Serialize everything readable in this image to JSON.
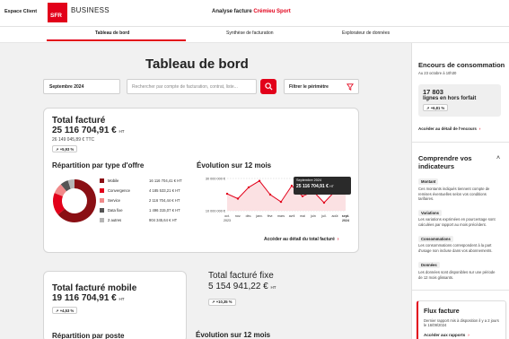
{
  "header": {
    "espace_client": "Espace Client",
    "logo_text": "SFR",
    "brand": "BUSINESS",
    "title_prefix": "Analyse facture",
    "title_company": "Crémieu Sport"
  },
  "tabs": [
    {
      "label": "Tableau de bord",
      "active": true
    },
    {
      "label": "Synthèse de facturation",
      "active": false
    },
    {
      "label": "Explorateur de données",
      "active": false
    }
  ],
  "page_title": "Tableau de bord",
  "filters": {
    "period": "Septembre 2024",
    "search_placeholder": "Rechercher par compte de facturation, contrat, liste...",
    "filter_label": "Filtrer le périmètre"
  },
  "total": {
    "label": "Total facturé",
    "value": "25 116 704,91 €",
    "unit": "HT",
    "ttc": "26 149 045,89 € TTC",
    "badge": "+5,93 %"
  },
  "repartition": {
    "title": "Répartition par type d'offre",
    "items": [
      {
        "name": "Mobile",
        "value": "16 116 704,41 € HT",
        "share": 0.64,
        "color": "#8a0f14"
      },
      {
        "name": "Convergence",
        "value": "4 185 533,21 € HT",
        "share": 0.17,
        "color": "#e2001a"
      },
      {
        "name": "Service",
        "value": "2 116 704,44 € HT",
        "share": 0.08,
        "color": "#f08a8a"
      },
      {
        "name": "Data fixe",
        "value": "1 496 315,07 € HT",
        "share": 0.06,
        "color": "#555555"
      },
      {
        "name": "2 autres",
        "value": "904 345,64 € HT",
        "share": 0.05,
        "color": "#b5b5b5"
      }
    ]
  },
  "evolution": {
    "title": "Évolution sur 12 mois",
    "tooltip_month": "Septembre 2024",
    "tooltip_value": "25 116 704,91 €",
    "tooltip_unit": "HT"
  },
  "chart_data": {
    "type": "line",
    "title": "Évolution sur 12 mois",
    "categories": [
      "oct.",
      "nov.",
      "déc.",
      "janv.",
      "févr.",
      "mars",
      "avril",
      "mai",
      "juin",
      "juil.",
      "août",
      "sept."
    ],
    "first_year": "2023",
    "last_year": "2024",
    "y_ticks": [
      "30 000 000 €",
      "10 000 000 €"
    ],
    "ylim": [
      10000000,
      30000000
    ],
    "series": [
      {
        "values": [
          20500000,
          17500000,
          24500000,
          28500000,
          20000000,
          15500000,
          25500000,
          19000000,
          22000000,
          15000000,
          22000000,
          25116705
        ]
      }
    ],
    "line_color": "#e2001a"
  },
  "detail_link": "Accéder au détail du total facturé",
  "mobile": {
    "label": "Total facturé mobile",
    "value": "19 116 704,91 €",
    "unit": "HT",
    "badge": "+4,53 %"
  },
  "fixe": {
    "label": "Total facturé fixe",
    "value": "5 154 941,22 €",
    "unit": "HT",
    "badge": "+10,35 %"
  },
  "bottom": {
    "repartition_poste": "Répartition par poste",
    "evolution_title": "Évolution sur 12 mois"
  },
  "right": {
    "encours_title": "Encours de consommation",
    "encours_date": "Au 23 octobre à 10h30",
    "encours_value": "17 803",
    "encours_label": "lignes en hors forfait",
    "encours_badge": "+6,81 %",
    "encours_link": "Accéder au détail de l'encours",
    "indic_title": "Comprendre vos indicateurs",
    "indic": [
      {
        "name": "Montant",
        "text": "Ces montants indiqués tiennent compte de remises éventuelles selon vos conditions tarifaires."
      },
      {
        "name": "Variations",
        "text": "Les variations exprimées en pourcentage sont calculées par rapport au mois précédent."
      },
      {
        "name": "Consommations",
        "text": "Les consommations correspondent à la part d'usage non incluse dans vos abonnements."
      },
      {
        "name": "Données",
        "text": "Les données sont disponibles sur une période de 12 mois glissants."
      }
    ],
    "flux_title": "Flux facture",
    "flux_text": "Dernier rapport mis à disposition il y a 2 jours le 16/09/2024",
    "flux_link": "Accéder aux rapports"
  }
}
